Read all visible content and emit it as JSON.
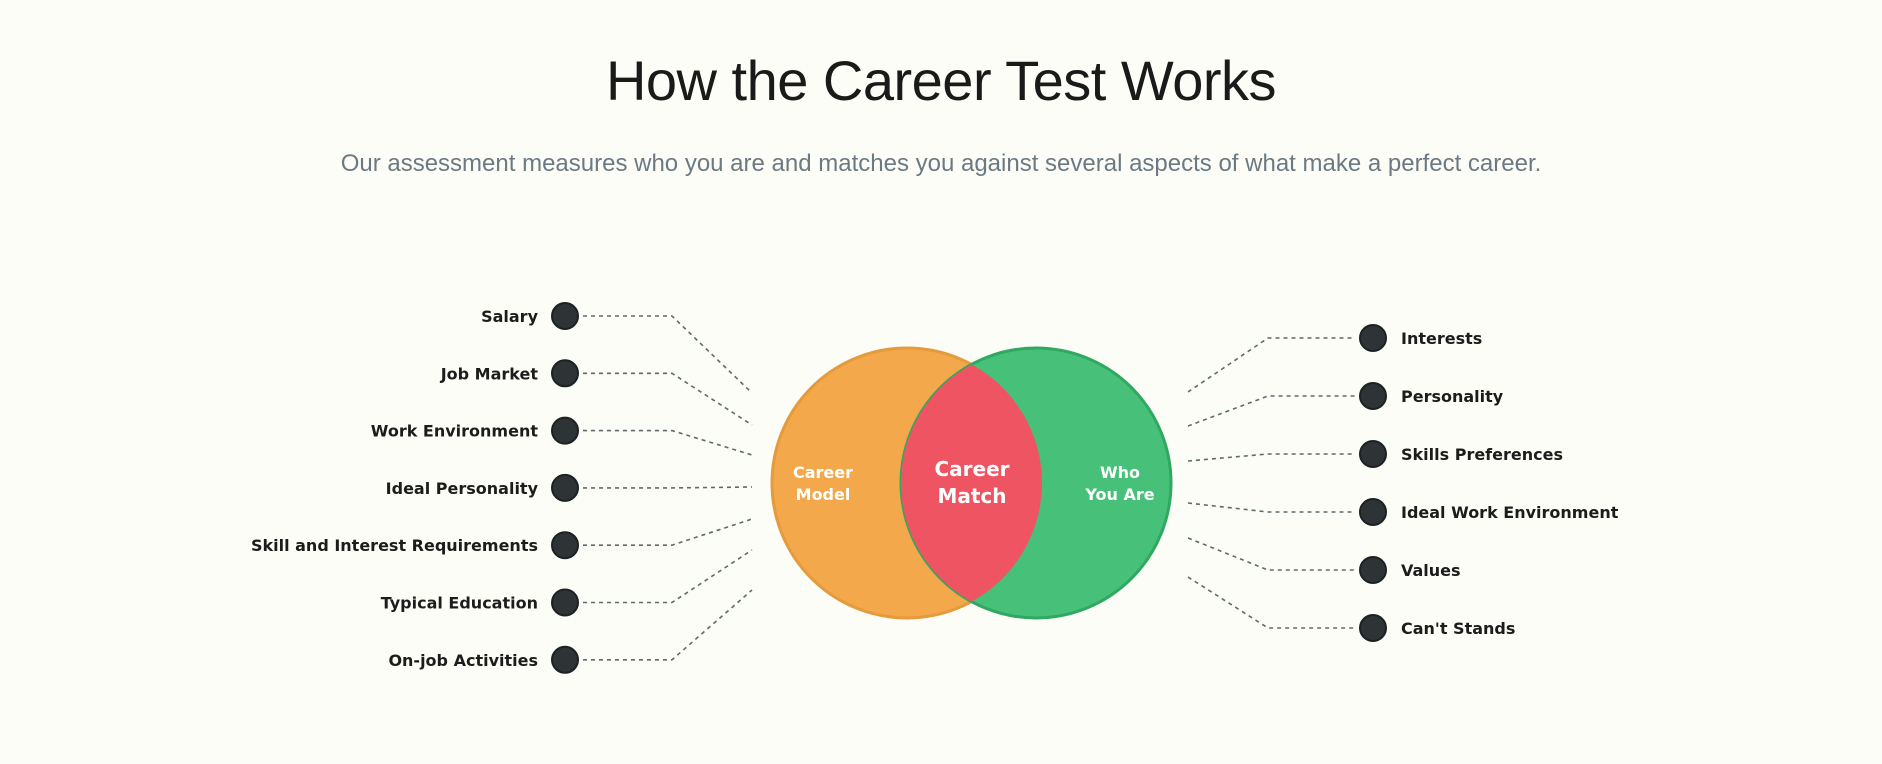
{
  "header": {
    "title": "How the Career Test Works",
    "subtitle": "Our assessment measures who you are and matches you against several aspects of what make a perfect career."
  },
  "venn": {
    "left": {
      "line1": "Career",
      "line2": "Model",
      "color": "#f2a84b",
      "stroke": "#e59a3c"
    },
    "center": {
      "line1": "Career",
      "line2": "Match",
      "color": "#ef5463"
    },
    "right": {
      "line1": "Who",
      "line2": "You Are",
      "color": "#47c07a",
      "stroke": "#2fa862"
    }
  },
  "left_items": [
    "Salary",
    "Job Market",
    "Work Environment",
    "Ideal Personality",
    "Skill and Interest Requirements",
    "Typical Education",
    "On-job Activities"
  ],
  "right_items": [
    "Interests",
    "Personality",
    "Skills Preferences",
    "Ideal Work Environment",
    "Values",
    "Can't Stands"
  ],
  "colors": {
    "dot": "#2e3436",
    "connector": "#5b6b6e"
  }
}
